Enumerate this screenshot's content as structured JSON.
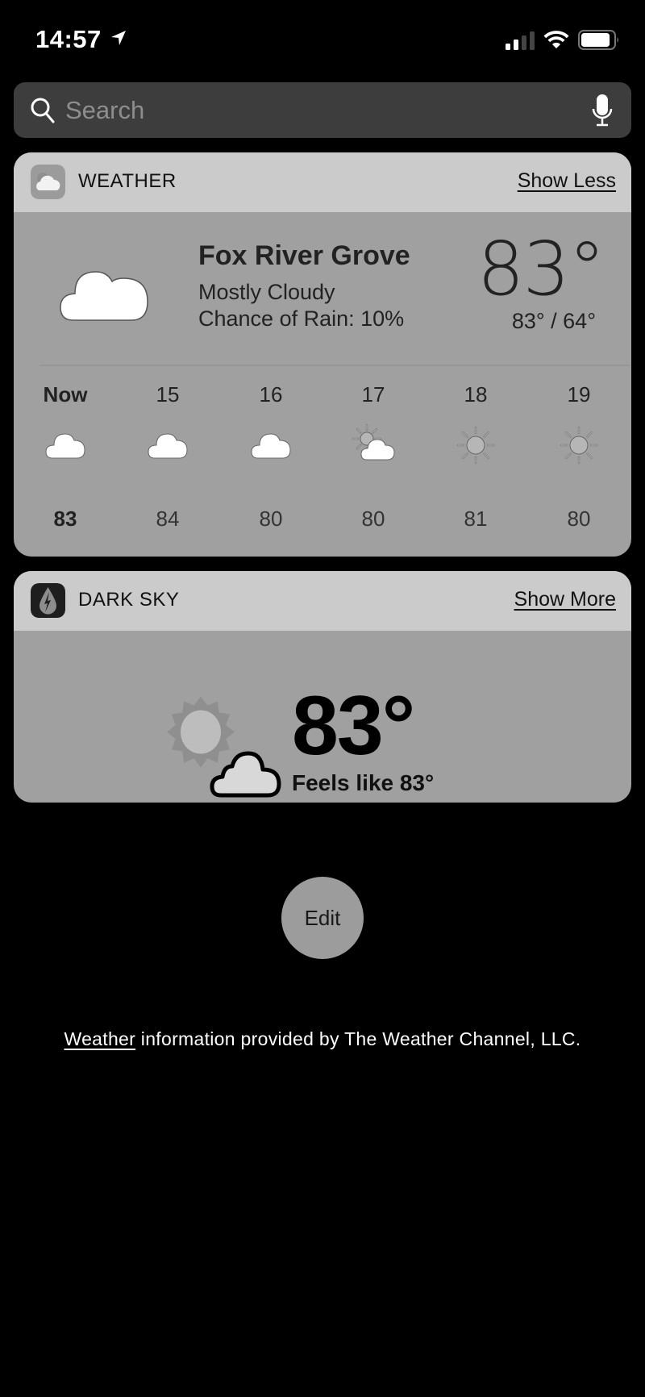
{
  "status_bar": {
    "time": "14:57",
    "location_icon": "location-arrow-icon",
    "signal_bars_active": 2,
    "signal_bars_total": 4,
    "wifi_icon": "wifi-icon",
    "battery_level": 0.9
  },
  "search": {
    "placeholder": "Search",
    "value": "",
    "icon": "search-icon",
    "mic_icon": "microphone-icon"
  },
  "weather_widget": {
    "app_name": "WEATHER",
    "app_icon": "weather-app-icon",
    "toggle_label": "Show Less",
    "location": "Fox River Grove",
    "condition": "Mostly Cloudy",
    "rain_chance": "Chance of Rain: 10%",
    "current_temp": "83°",
    "hi_lo": "83° / 64°",
    "condition_icon": "cloud-icon",
    "hourly": [
      {
        "label": "Now",
        "icon": "cloud",
        "temp": "83"
      },
      {
        "label": "15",
        "icon": "cloud",
        "temp": "84"
      },
      {
        "label": "16",
        "icon": "cloud",
        "temp": "80"
      },
      {
        "label": "17",
        "icon": "partly-sunny",
        "temp": "80"
      },
      {
        "label": "18",
        "icon": "sun",
        "temp": "81"
      },
      {
        "label": "19",
        "icon": "sun",
        "temp": "80"
      }
    ]
  },
  "darksky_widget": {
    "app_name": "DARK SKY",
    "app_icon": "dark-sky-app-icon",
    "toggle_label": "Show More",
    "temp": "83°",
    "feels_like": "Feels like 83°",
    "condition_icon": "partly-cloudy-icon"
  },
  "edit_button": {
    "label": "Edit"
  },
  "footer": {
    "link_text": "Weather",
    "text": " information provided by The Weather Channel, LLC."
  }
}
